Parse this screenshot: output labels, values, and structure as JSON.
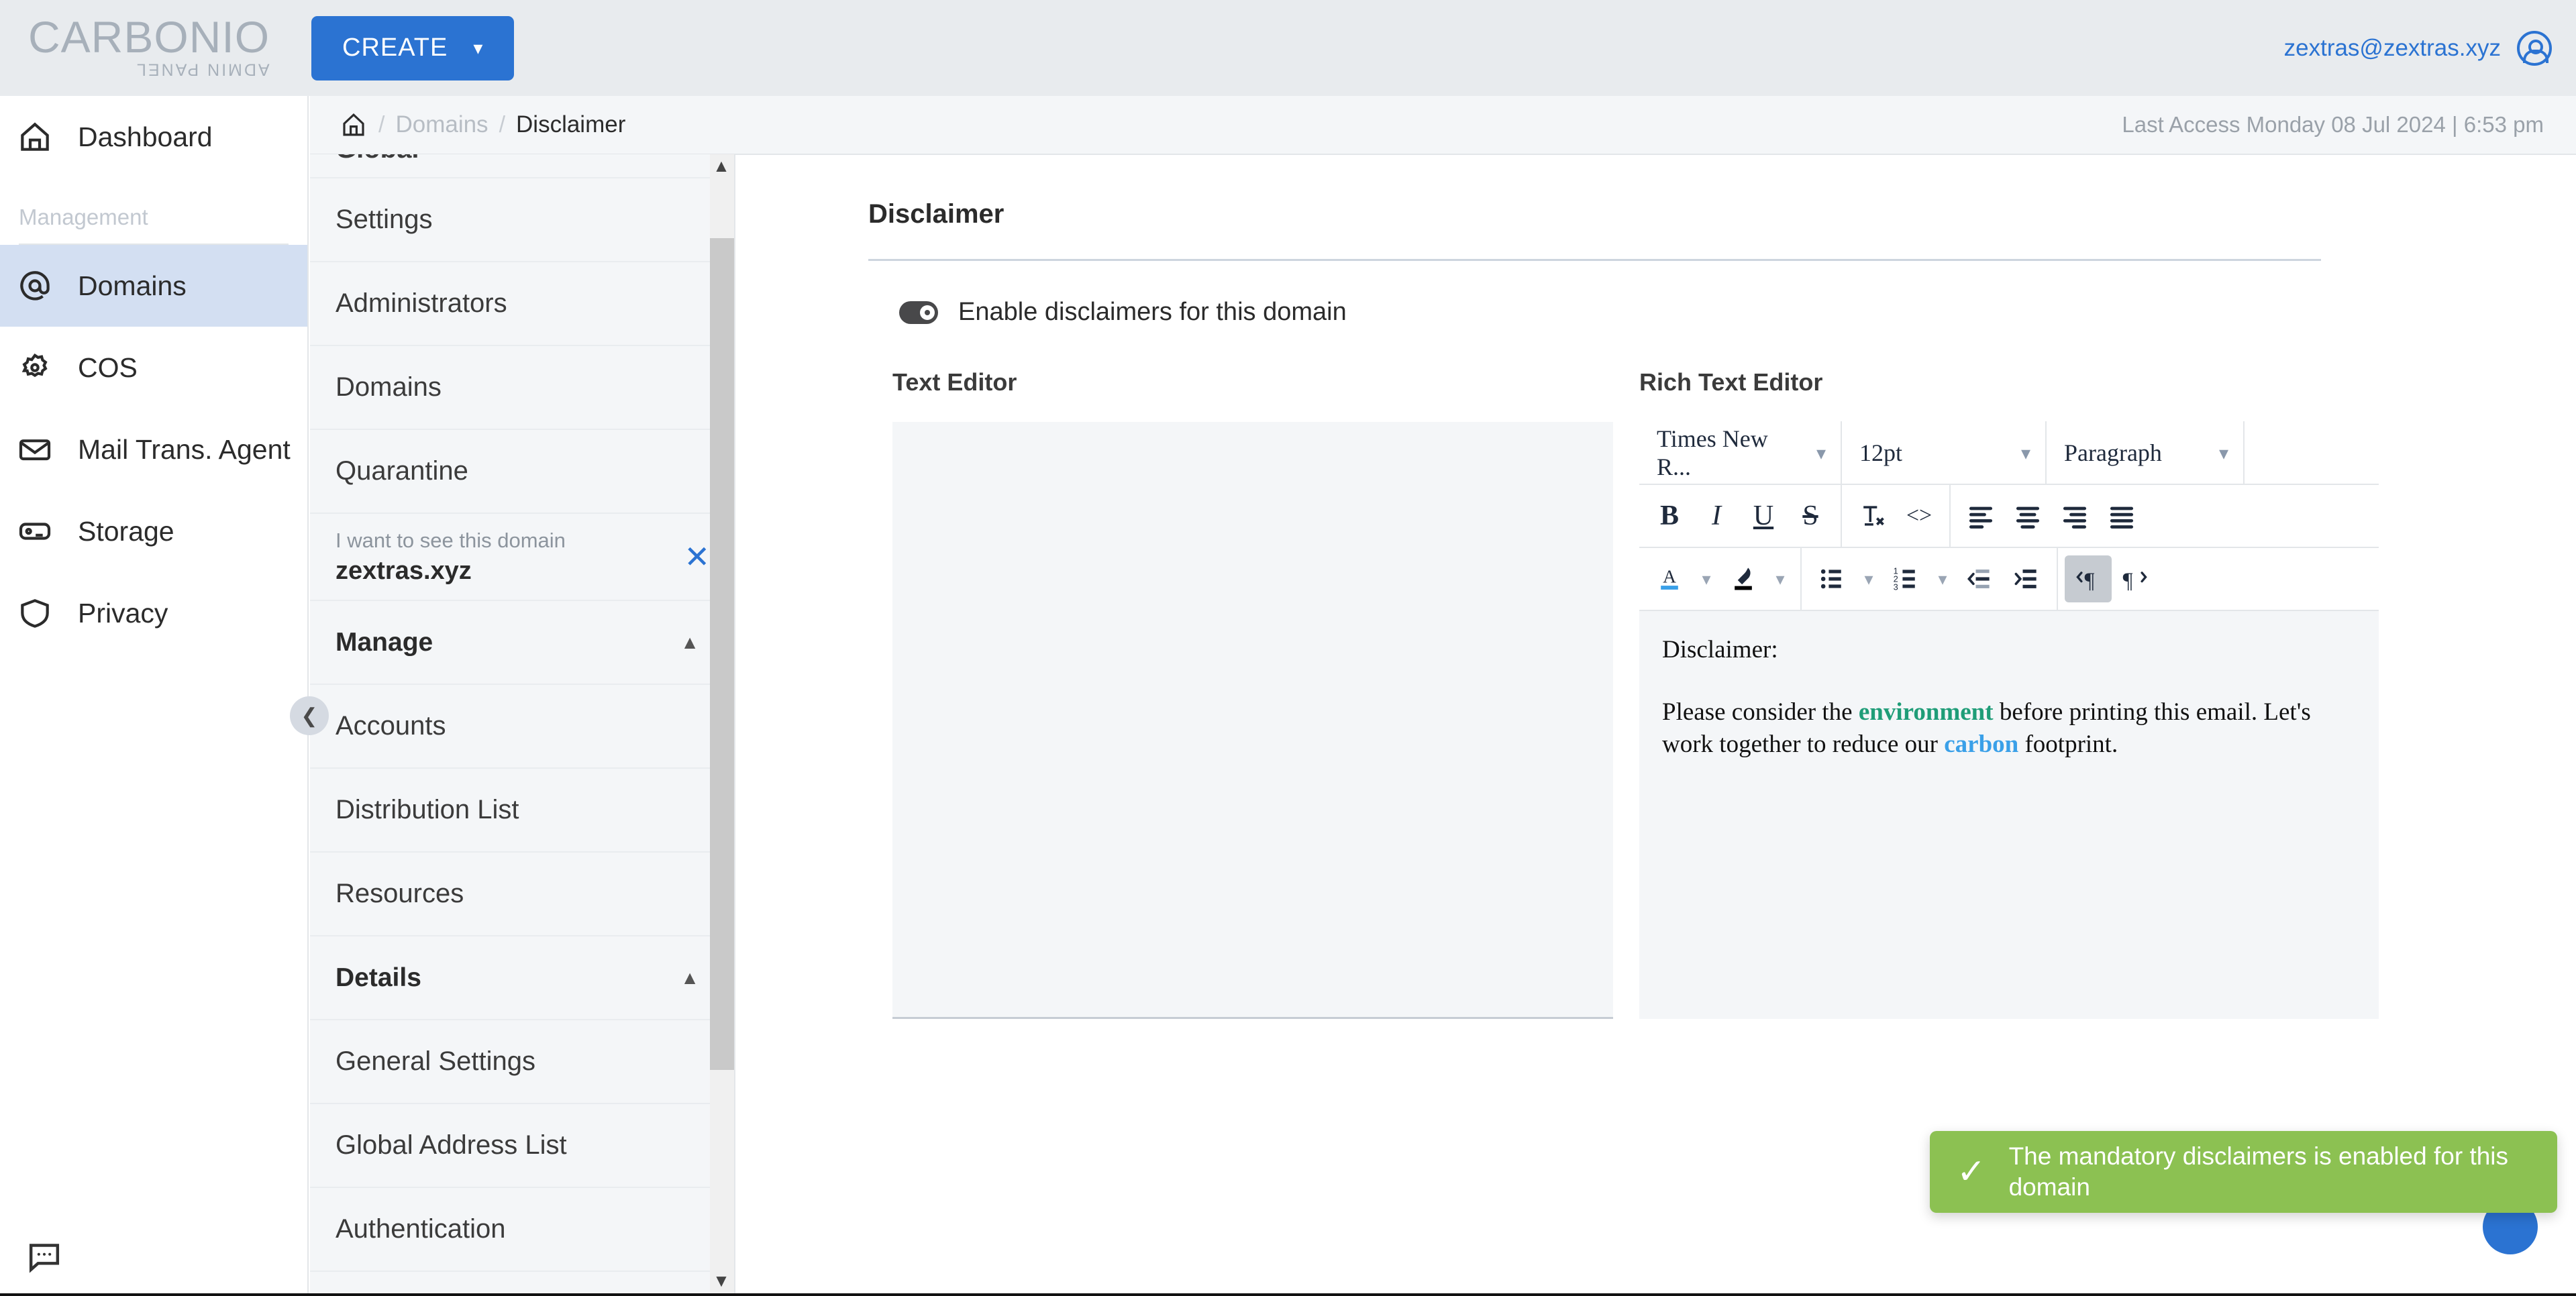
{
  "topbar": {
    "logo_main": "CARBONIO",
    "logo_sub": "ADMIN PANEL",
    "create_label": "CREATE",
    "create_caret": "chevron-down-icon",
    "user_email": "zextras@zextras.xyz",
    "accent_blue": "#2b73d2",
    "background": "#e8ebee"
  },
  "leftnav": {
    "dashboard": {
      "label": "Dashboard",
      "icon": "home-icon"
    },
    "section_label": "Management",
    "items": [
      {
        "label": "Domains",
        "icon": "at-sign-icon",
        "active": true
      },
      {
        "label": "COS",
        "icon": "gear-icon",
        "active": false
      },
      {
        "label": "Mail Trans. Agent",
        "icon": "envelope-icon",
        "active": false
      },
      {
        "label": "Storage",
        "icon": "drive-icon",
        "active": false
      },
      {
        "label": "Privacy",
        "icon": "shield-icon",
        "active": false
      }
    ],
    "active_background": "#d3dff2"
  },
  "subpanel": {
    "cut_item": "Global",
    "items_top": [
      "Settings",
      "Administrators",
      "Domains",
      "Quarantine"
    ],
    "domain_selector": {
      "hint": "I want to see this domain",
      "value": "zextras.xyz",
      "close_icon": "close-icon"
    },
    "group_manage": {
      "label": "Manage",
      "caret": "chevron-up-icon"
    },
    "items_manage": [
      "Accounts",
      "Distribution List",
      "Resources"
    ],
    "group_details": {
      "label": "Details",
      "caret": "chevron-up-icon"
    },
    "items_details": [
      "General Settings",
      "Global Address List",
      "Authentication"
    ],
    "scroll_up_icon": "chevron-up-icon",
    "scroll_down_icon": "chevron-down-icon",
    "collapse_icon": "chevron-left-icon"
  },
  "breadcrumb": {
    "home_icon": "home-icon",
    "sep": "/",
    "parent": "Domains",
    "current": "Disclaimer",
    "last_access": "Last Access Monday 08 Jul 2024 | 6:53 pm"
  },
  "main": {
    "section_title": "Disclaimer",
    "toggle": {
      "label": "Enable disclaimers for this domain",
      "state": "on",
      "icon": "toggle-on-icon"
    },
    "text_editor": {
      "label": "Text Editor",
      "value": "",
      "placeholder": ""
    },
    "rich_editor": {
      "label": "Rich Text Editor",
      "font_family": "Times New R...",
      "font_size": "12pt",
      "block_format": "Paragraph",
      "toolbar_row2": [
        {
          "name": "bold-icon",
          "glyph": "B"
        },
        {
          "name": "italic-icon",
          "glyph": "I"
        },
        {
          "name": "underline-icon",
          "glyph": "U"
        },
        {
          "name": "strikethrough-icon",
          "glyph": "S"
        },
        {
          "name": "clear-formatting-icon",
          "glyph": "Tx"
        },
        {
          "name": "source-code-icon",
          "glyph": "<>"
        },
        {
          "name": "align-left-icon",
          "glyph": ""
        },
        {
          "name": "align-center-icon",
          "glyph": ""
        },
        {
          "name": "align-right-icon",
          "glyph": ""
        },
        {
          "name": "align-justify-icon",
          "glyph": ""
        }
      ],
      "toolbar_row3": [
        {
          "name": "text-color-icon",
          "glyph": "A",
          "swatch": "#3aa0e8"
        },
        {
          "name": "highlight-color-icon",
          "glyph": "",
          "swatch": "#000000"
        },
        {
          "name": "bullet-list-icon",
          "glyph": ""
        },
        {
          "name": "numbered-list-icon",
          "glyph": ""
        },
        {
          "name": "outdent-icon",
          "glyph": ""
        },
        {
          "name": "indent-icon",
          "glyph": ""
        },
        {
          "name": "ltr-direction-icon",
          "glyph": "",
          "active": true
        },
        {
          "name": "rtl-direction-icon",
          "glyph": "",
          "active": false
        }
      ],
      "content": {
        "line1": "Disclaimer:",
        "line2_a": "Please consider the ",
        "line2_em1": "environment",
        "line2_b": " before printing this email. Let's work together to reduce our ",
        "line2_em2": "carbon",
        "line2_c": " footprint."
      },
      "em1_color": "#1f9d78",
      "em2_color": "#3aa0e8"
    }
  },
  "toast": {
    "icon": "check-icon",
    "message": "The mandatory disclaimers is enabled for this domain",
    "background": "#8cc152"
  },
  "chat_fab": {
    "icon": "chat-bubble-icon"
  }
}
